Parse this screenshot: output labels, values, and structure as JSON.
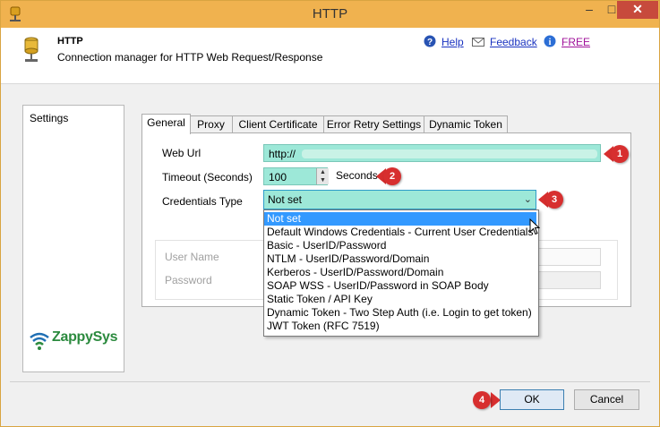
{
  "window": {
    "title": "HTTP",
    "minimize": "–",
    "maximize": "□",
    "close": "✕"
  },
  "header": {
    "title": "HTTP",
    "subtitle": "Connection manager for HTTP Web Request/Response",
    "links": {
      "help": "Help",
      "feedback": "Feedback",
      "free": "FREE"
    }
  },
  "sidebar": {
    "items": [
      {
        "label": "Settings"
      }
    ],
    "logo": {
      "part1": "Zappy",
      "part2": "Sys"
    }
  },
  "tabs": [
    {
      "label": "General",
      "active": true
    },
    {
      "label": "Proxy"
    },
    {
      "label": "Client Certificate"
    },
    {
      "label": "Error Retry Settings"
    },
    {
      "label": "Dynamic Token"
    }
  ],
  "general": {
    "web_url_label": "Web Url",
    "web_url_value": "http://",
    "timeout_label": "Timeout (Seconds)",
    "timeout_value": "100",
    "timeout_unit": "Seconds",
    "credentials_label": "Credentials Type",
    "credentials_value": "Not set",
    "user_name_label": "User Name",
    "password_label": "Password"
  },
  "dropdown": {
    "options": [
      "Not set",
      "Default Windows Credentials - Current User Credentials",
      "Basic - UserID/Password",
      "NTLM - UserID/Password/Domain",
      "Kerberos - UserID/Password/Domain",
      "SOAP WSS - UserID/Password in SOAP Body",
      "Static Token / API Key",
      "Dynamic Token - Two Step Auth (i.e. Login to get token)",
      "JWT Token (RFC 7519)"
    ],
    "selected_index": 0
  },
  "badges": [
    "1",
    "2",
    "3",
    "4"
  ],
  "buttons": {
    "ok": "OK",
    "cancel": "Cancel"
  },
  "colors": {
    "title_bar": "#f0b24f",
    "close": "#c74a3c",
    "field": "#9de8d8",
    "badge": "#d72f2f",
    "selection": "#3399ff",
    "link": "#1a33c0"
  }
}
